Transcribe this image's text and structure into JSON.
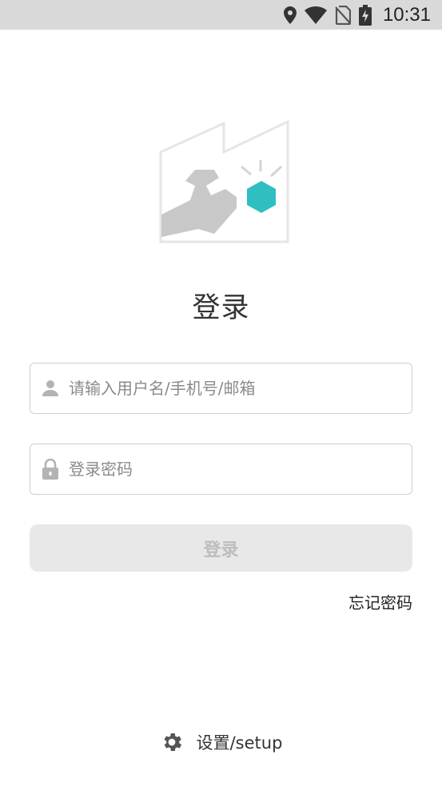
{
  "status_bar": {
    "time": "10:31",
    "icons": [
      "location-icon",
      "wifi-icon",
      "no-sim-icon",
      "battery-charging-icon"
    ]
  },
  "login": {
    "title": "登录",
    "username": {
      "value": "",
      "placeholder": "请输入用户名/手机号/邮箱",
      "icon": "user-icon"
    },
    "password": {
      "value": "",
      "placeholder": "登录密码",
      "icon": "lock-icon"
    },
    "submit_label": "登录",
    "forgot_label": "忘记密码"
  },
  "footer": {
    "setup_label": "设置/setup",
    "icon": "gear-icon"
  },
  "colors": {
    "accent_teal": "#2fbfc0",
    "status_bar_bg": "#d9d9d9",
    "button_disabled_bg": "#e8e8e8",
    "button_disabled_text": "#bdbdbd"
  }
}
